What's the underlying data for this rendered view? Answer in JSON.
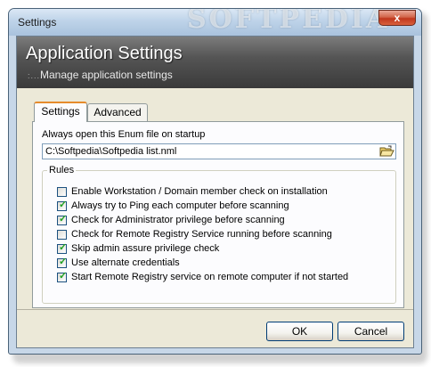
{
  "window": {
    "title": "Settings",
    "watermark": "SOFTPEDIA",
    "close_label": "x"
  },
  "banner": {
    "title": "Application Settings",
    "subtitle": "Manage application settings"
  },
  "tabs": [
    {
      "label": "Settings",
      "active": true
    },
    {
      "label": "Advanced",
      "active": false
    }
  ],
  "startup": {
    "label": "Always open this Enum file on startup",
    "path_value": "C:\\Softpedia\\Softpedia list.nml"
  },
  "rules": {
    "legend": "Rules",
    "items": [
      {
        "label": "Enable Workstation / Domain member check on installation",
        "checked": false
      },
      {
        "label": "Always try to Ping each computer before scanning",
        "checked": true
      },
      {
        "label": "Check for Administrator privilege before scanning",
        "checked": true
      },
      {
        "label": "Check for Remote Registry Service running before scanning",
        "checked": false
      },
      {
        "label": "Skip admin assure privilege check",
        "checked": true
      },
      {
        "label": "Use alternate credentials",
        "checked": true
      },
      {
        "label": "Start Remote Registry service on remote computer if not started",
        "checked": true
      }
    ]
  },
  "buttons": {
    "ok": "OK",
    "cancel": "Cancel"
  },
  "colors": {
    "check_mark": "#21a121",
    "active_tab_accent": "#e68b2c"
  }
}
